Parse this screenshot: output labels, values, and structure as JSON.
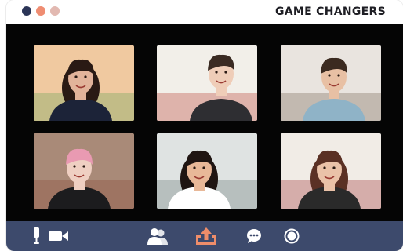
{
  "window": {
    "title": "GAME CHANGERS",
    "controls": [
      {
        "name": "window-dot-close",
        "color": "#2b3557"
      },
      {
        "name": "window-dot-minimize",
        "color": "#ef8d72"
      },
      {
        "name": "window-dot-maximize",
        "color": "#e2b9b1"
      }
    ]
  },
  "participants": [
    {
      "name": "participant-1",
      "bg": "#f0c9a0",
      "skin": "#e2b39a",
      "hair": "#2a1a14",
      "shirt": "#1c2338",
      "accent": "#6ea45a"
    },
    {
      "name": "participant-2",
      "bg": "#f2efe9",
      "skin": "#efcdb8",
      "hair": "#3a2a22",
      "shirt": "#2e2e32",
      "accent": "#b9463a"
    },
    {
      "name": "participant-3",
      "bg": "#e9e4df",
      "skin": "#e8c0a4",
      "hair": "#3b2a20",
      "shirt": "#8fb3c7",
      "accent": "#7a6a5a"
    },
    {
      "name": "participant-4",
      "bg": "#a98a78",
      "skin": "#efcfc2",
      "hair": "#e99ab2",
      "shirt": "#1c1c1e",
      "accent": "#8a4a38"
    },
    {
      "name": "participant-5",
      "bg": "#dfe3e2",
      "skin": "#e8b898",
      "hair": "#1f1512",
      "shirt": "#ffffff",
      "accent": "#6c7a7a"
    },
    {
      "name": "participant-6",
      "bg": "#f1ece6",
      "skin": "#eac2a8",
      "hair": "#5a3024",
      "shirt": "#2a2a2a",
      "accent": "#a03a3a"
    }
  ],
  "toolbar": {
    "icon_color": "#ffffff",
    "accent_color": "#ee8d6a",
    "buttons": [
      {
        "name": "microphone-icon"
      },
      {
        "name": "video-camera-icon"
      },
      {
        "name": "participants-icon"
      },
      {
        "name": "share-screen-icon"
      },
      {
        "name": "chat-icon"
      },
      {
        "name": "record-icon"
      }
    ]
  }
}
